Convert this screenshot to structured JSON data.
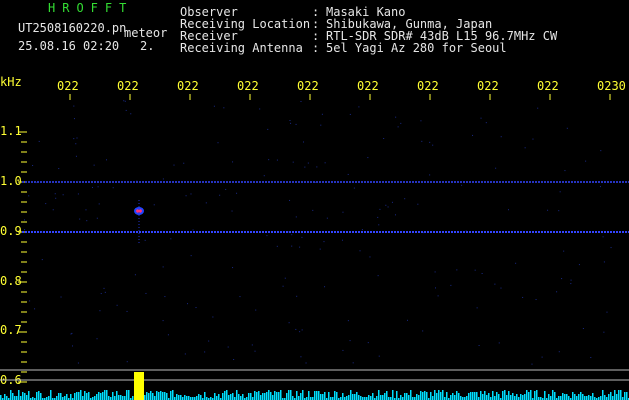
{
  "header": {
    "title": "HROFFT",
    "filename": "UT2508160220.pn",
    "detection_label": "meteor",
    "datetime": "25.08.16 02:20",
    "count": "2.",
    "meta": [
      {
        "key": "Observer",
        "value": "Masaki Kano"
      },
      {
        "key": "Receiving Location",
        "value": "Shibukawa, Gunma, Japan"
      },
      {
        "key": "Receiver",
        "value": "RTL-SDR SDR# 43dB L15 96.7MHz CW"
      },
      {
        "key": "Receiving Antenna",
        "value": "5el Yagi Az 280 for Seoul"
      }
    ]
  },
  "axes": {
    "y_unit": "kHz",
    "y_ticks": [
      "1.1",
      "1.0",
      "0.9",
      "0.8",
      "0.7",
      "0.6"
    ],
    "x_ticks": [
      "022",
      "022",
      "022",
      "022",
      "022",
      "022",
      "022",
      "022",
      "022",
      "0230"
    ]
  },
  "colors": {
    "background": "#000000",
    "axis_text": "#ffff33",
    "header_title": "#33dd33",
    "header_text": "#e6e6e6",
    "noise_line": "#3344ff",
    "spectrum": "#00e0ff",
    "meteor_peak": "#ffff00"
  }
}
